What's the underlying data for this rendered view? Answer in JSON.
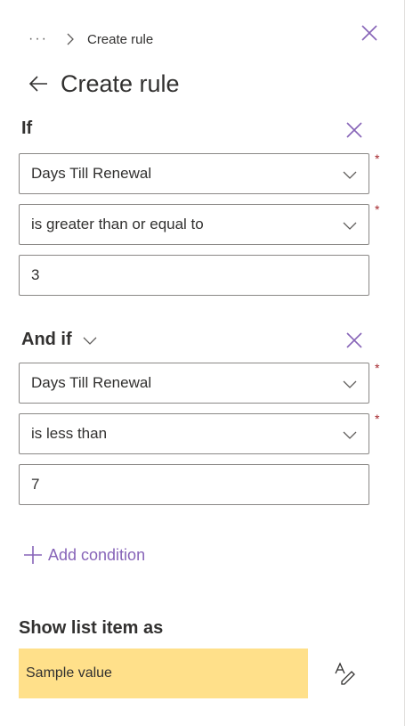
{
  "breadcrumb": {
    "dots": "···",
    "title": "Create rule"
  },
  "header": {
    "title": "Create rule"
  },
  "if_section": {
    "label": "If",
    "column_value": "Days Till Renewal",
    "operator_value": "is greater than or equal to",
    "value": "3"
  },
  "andif_section": {
    "label": "And if",
    "column_value": "Days Till Renewal",
    "operator_value": "is less than",
    "value": "7"
  },
  "required_mark": "*",
  "add_condition": {
    "label": "Add condition"
  },
  "show_as": {
    "label": "Show list item as",
    "sample": "Sample value"
  },
  "colors": {
    "accent": "#8764b8",
    "sample_bg": "#ffe08a",
    "required": "#a4262c"
  },
  "icons": [
    "more-icon",
    "chevron-right-icon",
    "close-icon",
    "back-arrow-icon",
    "chevron-down-icon",
    "add-icon",
    "format-icon"
  ]
}
